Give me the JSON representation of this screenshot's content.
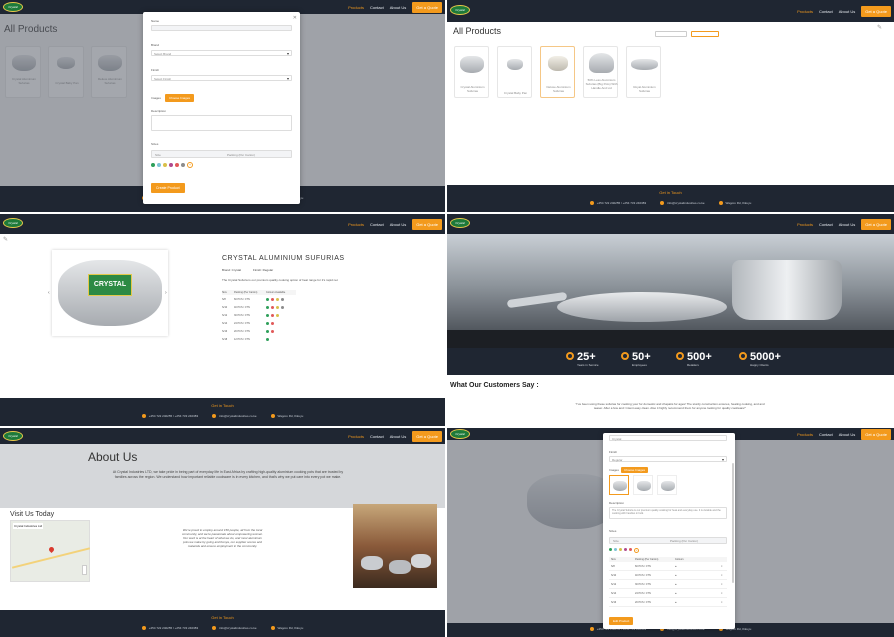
{
  "nav": {
    "logo_text": "Crystal",
    "links": [
      "Products",
      "Contact",
      "About Us",
      "Get a Quote"
    ]
  },
  "footer": {
    "get_in_touch": "Get in Touch",
    "phone": "+254 722 240255 / +254 733 240383",
    "email": "info@crystalindustries.co.ke",
    "address": "Wagoro Rd, Kikuyu"
  },
  "products_page": {
    "title": "All Products",
    "products": [
      "Crystal Aluminium Sufurias",
      "Crystal Baby Pan",
      "Deluxe Aluminium Sufurias",
      "50% Less Aluminium Sufurias (Big Pots) With Handle And Lid",
      "Royal Aluminium Sufurias"
    ]
  },
  "add_form": {
    "name_label": "Name",
    "brand_label": "Brand",
    "brand_value": "Select Brand",
    "finish_label": "Finish",
    "finish_value": "Select Finish",
    "images_label": "Images",
    "choose_images": "Choose Images",
    "description_label": "Description",
    "sizes_label": "Sizes",
    "size_col": "Size",
    "capacity_col": "Packing (Per Carton)",
    "create_button": "Create Product",
    "colors": [
      "#2e9f5a",
      "#7cc3d6",
      "#d9c04a",
      "#b04a8d",
      "#e15959",
      "#8c8c8c"
    ]
  },
  "detail_page": {
    "title": "CRYSTAL ALUMINIUM SUFURIAS",
    "brand": "Brand: Crystal",
    "finish": "Finish: Regular",
    "description": "The Crystal Sufuria is our premium quality cooking option of heat range for it's rapid net",
    "table_headers": [
      "Size",
      "Packing (Per Carton)",
      "Colours Available"
    ],
    "rows": [
      {
        "size": "S/8",
        "packing": "60 PCS / CTN"
      },
      {
        "size": "S/10",
        "packing": "40 PCS / CTN"
      },
      {
        "size": "S/12",
        "packing": "30 PCS / CTN"
      },
      {
        "size": "S/14",
        "packing": "24 PCS / CTN"
      },
      {
        "size": "S/16",
        "packing": "20 PCS / CTN"
      },
      {
        "size": "S/18",
        "packing": "12 PCS / CTN"
      }
    ],
    "pot_brand": "CRYSTAL"
  },
  "home_page": {
    "stats": [
      {
        "num": "25+",
        "label": "Years in Service"
      },
      {
        "num": "50+",
        "label": "Employees"
      },
      {
        "num": "500+",
        "label": "Retailers"
      },
      {
        "num": "5000+",
        "label": "Happy Clients"
      }
    ],
    "testimonials_title": "What Our Customers Say :",
    "testimonial": "\"I've been using these sufurias for cooking your for domestic and chapatis for ages! The sturdy construction ensures, heating cooking, and and teaser. After a few and I intent easy clean. Also it highly recommend them for anyone looking for quality cookware!\""
  },
  "about_page": {
    "title": "About Us",
    "text": "At Crystal Industries LTD, we take pride in being part of everyday life in East Africa by crafting high-quality aluminium cooking pots that are trusted by families across the region. We understand how important reliable cookware is in every kitchen, and that's why we put care into every pot we make.",
    "visit_title": "Visit Us Today",
    "map_place": "Crystal Industries Ltd",
    "quote": "We're proud to employ around 150 people, all from the local community, and we're passionate about empowering women. Our work is at the heart of what we do, and most aluminium pots we make by going and Kenya, our supplier source and materials and ensure employment in the community."
  },
  "edit_form": {
    "brand_value": "Crystal",
    "finish_label": "Finish",
    "finish_value": "Regular",
    "images_label": "Images",
    "choose_images": "Choose Images",
    "description_label": "Description",
    "description_value": "The Crystal Sufuria is our premium quality cooking for heat and everyday use. It is durable and the cooking with handles in bulk.",
    "sizes_label": "Sizes",
    "size_col": "Size",
    "packing_col": "Packing (Per Carton)",
    "colours_col": "Colours",
    "rows": [
      {
        "size": "S/8",
        "packing": "60 PCS / CTN"
      },
      {
        "size": "S/10",
        "packing": "40 PCS / CTN"
      },
      {
        "size": "S/12",
        "packing": "30 PCS / CTN"
      },
      {
        "size": "S/14",
        "packing": "24 PCS / CTN"
      },
      {
        "size": "S/16",
        "packing": "20 PCS / CTN"
      }
    ],
    "update_button": "Edit Product"
  }
}
